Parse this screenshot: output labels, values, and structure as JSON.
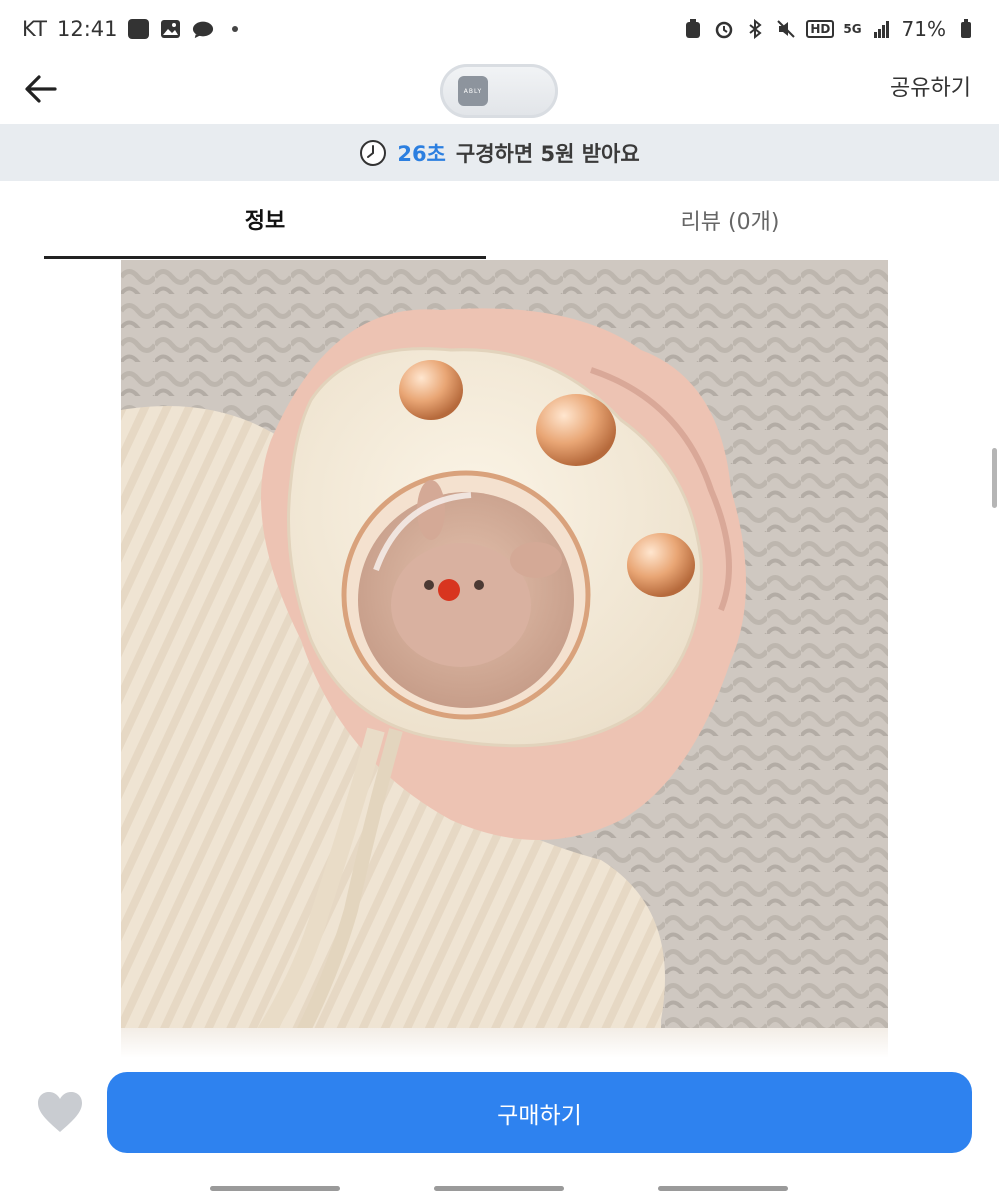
{
  "status_bar": {
    "carrier": "KT",
    "time": "12:41",
    "battery": "71%",
    "network": "5G",
    "hd": "HD"
  },
  "header": {
    "logo_text": "ABLY",
    "share_label": "공유하기"
  },
  "promo": {
    "seconds": "26초",
    "message": "구경하면 5원 받아요"
  },
  "tabs": [
    {
      "label": "정보",
      "active": true
    },
    {
      "label": "리뷰 (0개)",
      "active": false
    }
  ],
  "bottom": {
    "buy_label": "구매하기"
  },
  "colors": {
    "accent": "#2e82ef",
    "promo_highlight": "#2c7fe0",
    "banner_bg": "#e8ecf0"
  },
  "icons": {
    "back": "back-arrow-icon",
    "clock": "clock-icon",
    "heart": "heart-icon"
  }
}
